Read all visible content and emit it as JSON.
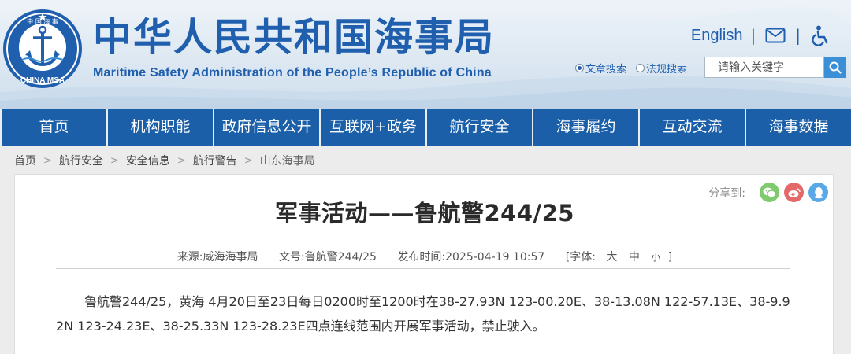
{
  "header": {
    "logo": {
      "top_text": "中 国 海 事",
      "bottom_text": "CHINA MSA"
    },
    "title_cn": "中华人民共和国海事局",
    "title_en": "Maritime Safety Administration of the People’s Republic of China",
    "english_link": "English",
    "separator": "|",
    "icons": [
      "envelope-icon",
      "accessibility-icon"
    ],
    "search": {
      "option_1": "文章搜索",
      "option_2": "法规搜索",
      "selected": "文章搜索",
      "placeholder": "请输入关键字"
    },
    "colors": {
      "brand": "#1f5fae",
      "nav": "#1b5fa8",
      "search_button": "#3b8fd6"
    }
  },
  "nav": {
    "items": [
      {
        "label": "首页"
      },
      {
        "label": "机构职能"
      },
      {
        "label": "政府信息公开"
      },
      {
        "label": "互联网+政务"
      },
      {
        "label": "航行安全"
      },
      {
        "label": "海事履约"
      },
      {
        "label": "互动交流"
      },
      {
        "label": "海事数据"
      }
    ]
  },
  "breadcrumb": {
    "items": [
      "首页",
      "航行安全",
      "安全信息",
      "航行警告",
      "山东海事局"
    ],
    "separator": ">"
  },
  "share": {
    "label": "分享到:",
    "targets": [
      "wechat-icon",
      "weibo-icon",
      "qq-icon"
    ]
  },
  "article": {
    "title": "军事活动——鲁航警244/25",
    "meta": {
      "source_label": "来源:",
      "source": "威海海事局",
      "doc_label": "文号:",
      "doc_no": "鲁航警244/25",
      "date_label": "发布时间:",
      "date": "2025-04-19 10:57",
      "font_label": "[字体:",
      "size_large": "大",
      "size_medium": "中",
      "size_small": "小",
      "font_close": "]"
    },
    "body": "鲁航警244/25，黄海 4月20日至23日每日0200时至1200时在38-27.93N 123-00.20E、38-13.08N 122-57.13E、38-9.92N 123-24.23E、38-25.33N 123-28.23E四点连线范围内开展军事活动，禁止驶入。"
  }
}
